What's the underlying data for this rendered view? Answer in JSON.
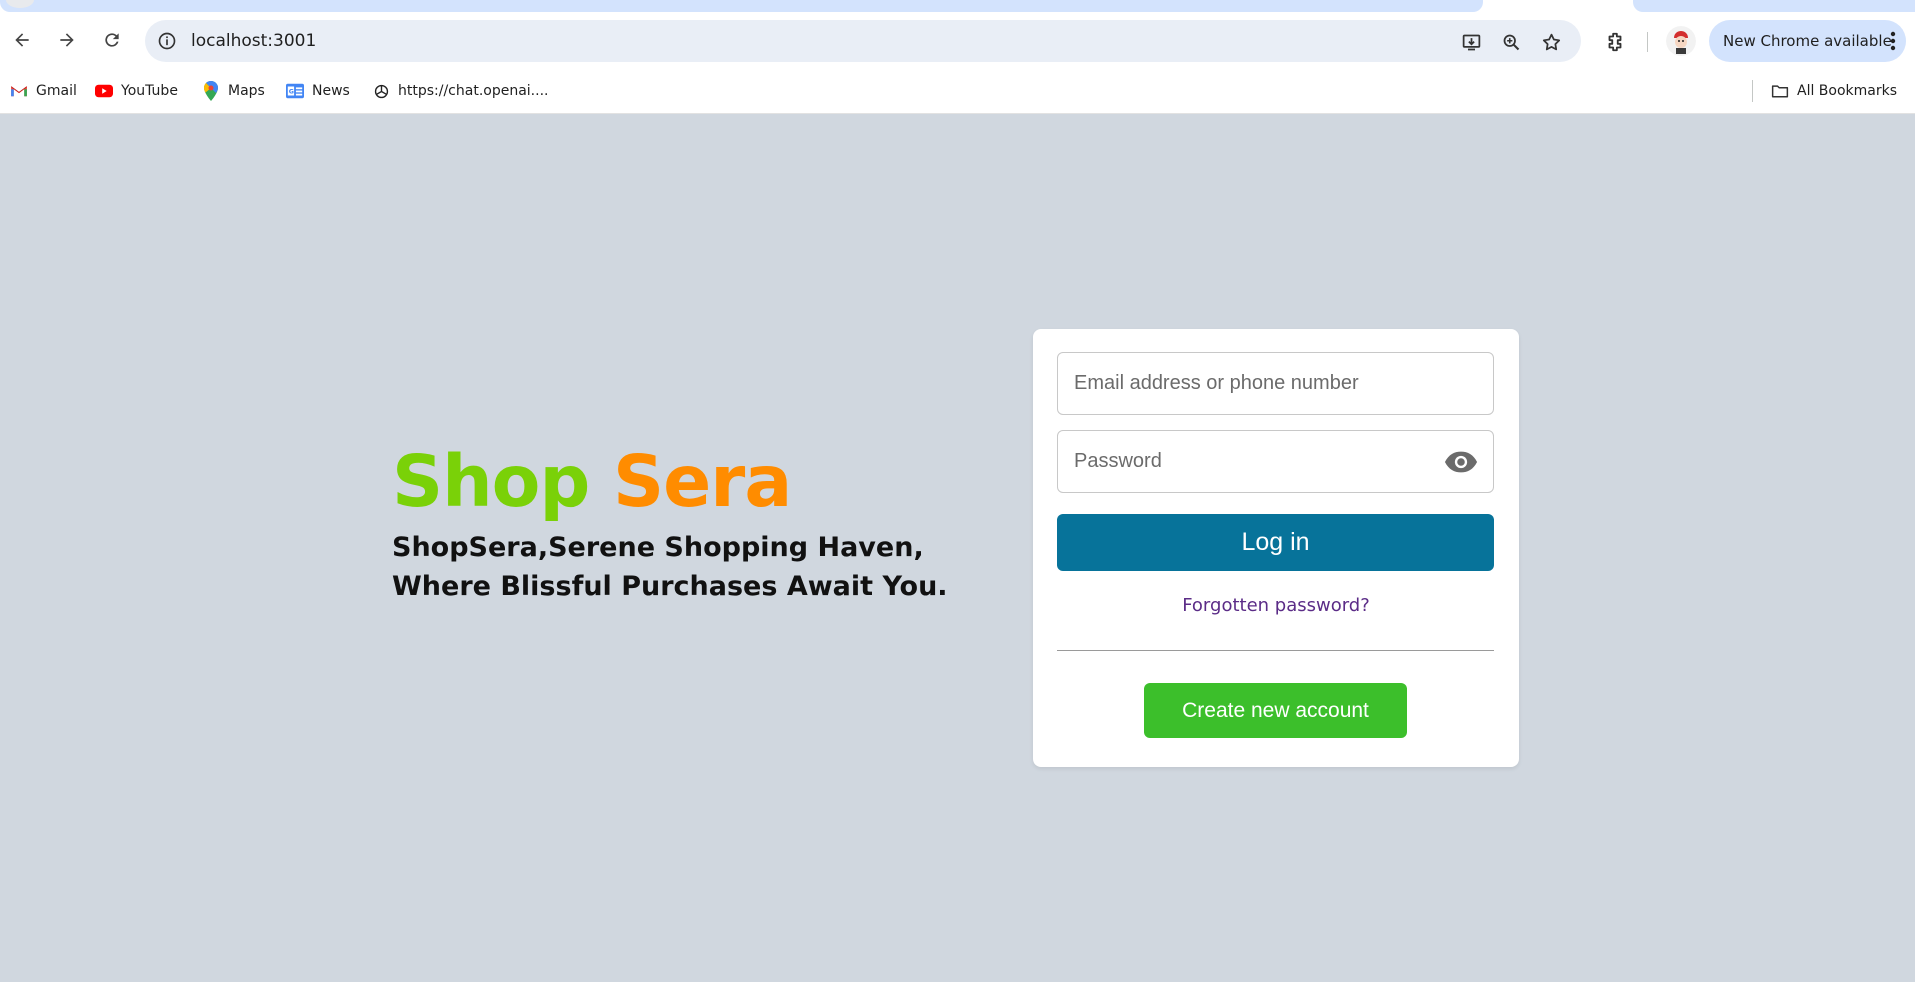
{
  "browser": {
    "url": "localhost:3001",
    "update_chip_label": "New Chrome available",
    "bookmarks": [
      {
        "label": "Gmail",
        "icon": "gmail-icon"
      },
      {
        "label": "YouTube",
        "icon": "youtube-icon"
      },
      {
        "label": "Maps",
        "icon": "maps-icon"
      },
      {
        "label": "News",
        "icon": "news-icon"
      },
      {
        "label": "https://chat.openai....",
        "icon": "openai-icon"
      }
    ],
    "all_bookmarks_label": "All Bookmarks"
  },
  "brand": {
    "title_part1": "Shop",
    "title_part2": "Sera",
    "tagline_line1": "ShopSera,Serene Shopping Haven,",
    "tagline_line2": "Where Blissful Purchases Await You."
  },
  "login": {
    "email_placeholder": "Email address or phone number",
    "password_placeholder": "Password",
    "login_label": "Log in",
    "forgot_label": "Forgotten password?",
    "create_label": "Create new account"
  },
  "colors": {
    "brand_green": "#7ad108",
    "brand_orange": "#ff8c00",
    "login_button": "#07739a",
    "create_button": "#3cbf2b",
    "page_background": "#d0d7df"
  }
}
